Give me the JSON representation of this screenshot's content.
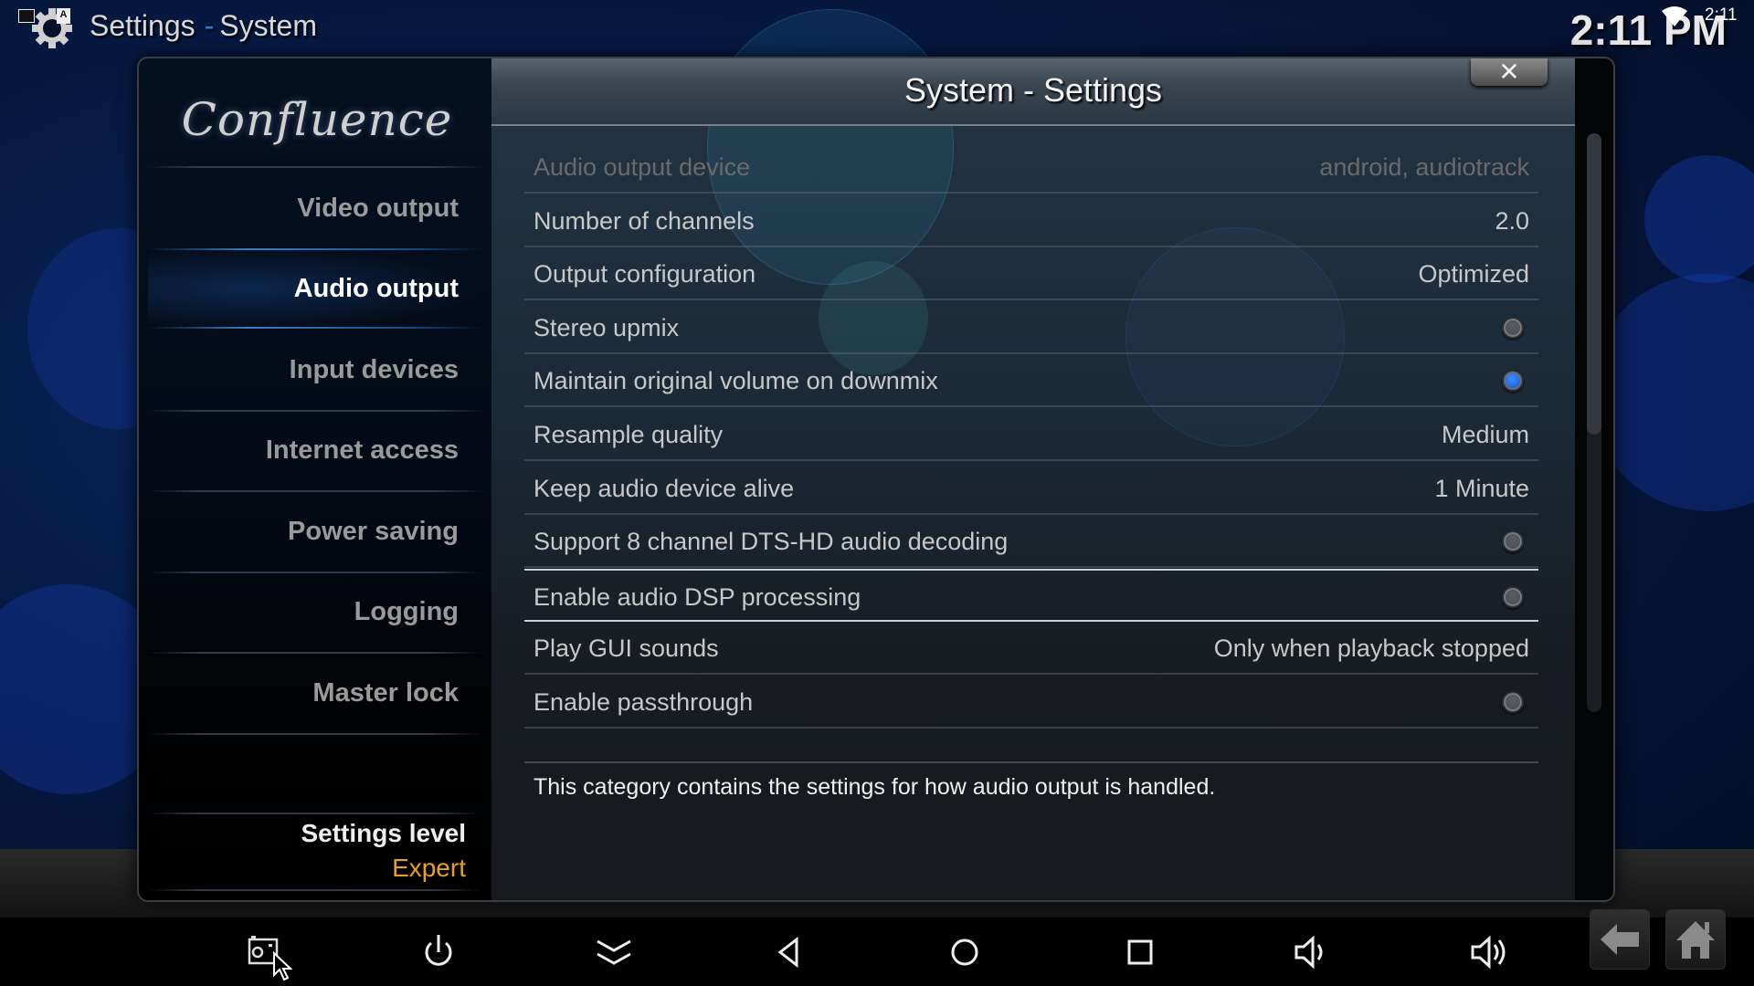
{
  "statusbar": {
    "breadcrumb_section": "Settings",
    "breadcrumb_separator": "-",
    "breadcrumb_page": "System",
    "clock": "2:11 PM",
    "system_time": "2:11",
    "icons": [
      "image-notification-icon",
      "text-notification-icon",
      "settings-gear-icon",
      "wifi-icon"
    ]
  },
  "dialog": {
    "logo_text": "Confluence",
    "title": "System - Settings",
    "close_label": "✕",
    "sidebar": {
      "items": [
        {
          "label": "Video output",
          "active": false
        },
        {
          "label": "Audio output",
          "active": true
        },
        {
          "label": "Input devices",
          "active": false
        },
        {
          "label": "Internet access",
          "active": false
        },
        {
          "label": "Power saving",
          "active": false
        },
        {
          "label": "Logging",
          "active": false
        },
        {
          "label": "Master lock",
          "active": false
        }
      ],
      "settings_level_label": "Settings level",
      "settings_level_value": "Expert"
    },
    "settings": [
      {
        "label": "Audio output device",
        "value": "android, audiotrack",
        "type": "value",
        "disabled": true
      },
      {
        "label": "Number of channels",
        "value": "2.0",
        "type": "value"
      },
      {
        "label": "Output configuration",
        "value": "Optimized",
        "type": "value"
      },
      {
        "label": "Stereo upmix",
        "checked": false,
        "type": "toggle"
      },
      {
        "label": "Maintain original volume on downmix",
        "checked": true,
        "type": "toggle"
      },
      {
        "label": "Resample quality",
        "value": "Medium",
        "type": "value"
      },
      {
        "label": "Keep audio device alive",
        "value": "1 Minute",
        "type": "value"
      },
      {
        "label": "Support 8 channel DTS-HD audio decoding",
        "checked": false,
        "type": "toggle"
      },
      {
        "label": "Enable audio DSP processing",
        "checked": false,
        "type": "toggle",
        "focused": true
      },
      {
        "label": "Play GUI sounds",
        "value": "Only when playback stopped",
        "type": "value"
      },
      {
        "label": "Enable passthrough",
        "checked": false,
        "type": "toggle"
      }
    ],
    "description": "This category contains the settings for how audio output is handled.",
    "scroll_visible_fraction": 0.52
  },
  "android_nav": {
    "buttons": [
      "screenshot",
      "power",
      "hide-bar",
      "back",
      "home",
      "recents",
      "volume-down",
      "volume-up"
    ]
  },
  "kodi_buttons": [
    "back",
    "home"
  ],
  "colors": {
    "accent_blue": "#2a7fd4",
    "settings_level_value": "#e8a020",
    "toggle_on": "#1c5fd8"
  }
}
